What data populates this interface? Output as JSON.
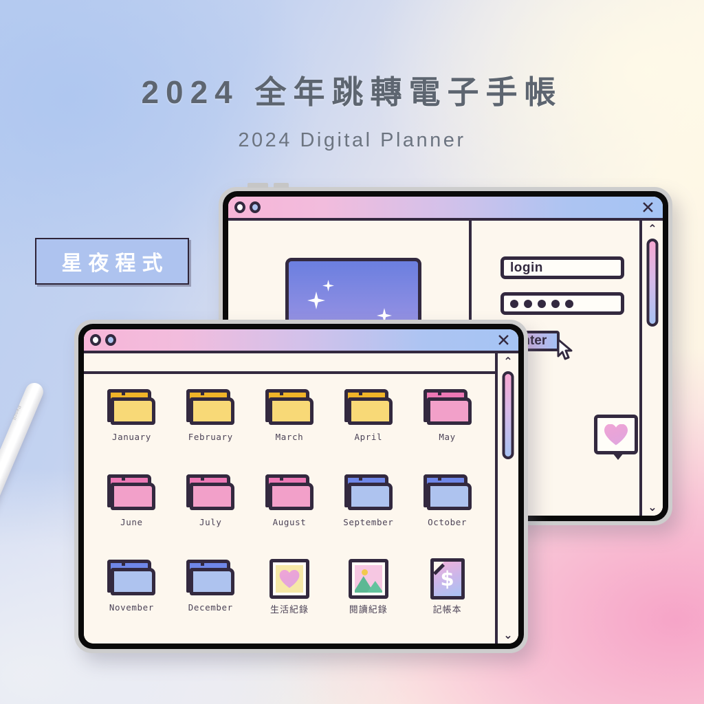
{
  "page": {
    "title": "2024 全年跳轉電子手帳",
    "subtitle": "2024 Digital Planner",
    "badge": "星夜程式"
  },
  "colors": {
    "outline": "#33293f",
    "paper": "#fdf7ee",
    "pink": "#f7a8d2",
    "blue": "#a5c4f4",
    "folder_yellow": "#f8d977",
    "folder_pink": "#f2a0c9",
    "folder_blue": "#aec3ef"
  },
  "back_window": {
    "titlebar": {
      "dot_left": "circle-white",
      "dot_right": "circle-blue",
      "close": "✕"
    },
    "left_panel": {
      "star_panel": "star-gradient-panel",
      "sparkles": 3
    },
    "login_form": {
      "username_value": "login",
      "password_dots": 5,
      "submit_label": "Enter",
      "cursor": "arrow-cursor"
    },
    "heart_bubble": "heart-speech-bubble",
    "scrollbar": {
      "up": "⌃",
      "down": "⌄"
    }
  },
  "front_window": {
    "titlebar": {
      "dot_left": "circle-white",
      "dot_right": "circle-blue",
      "close": "✕"
    },
    "scrollbar": {
      "up": "⌃",
      "down": "⌄"
    },
    "items": [
      {
        "label": "January",
        "type": "folder",
        "color": "yellow"
      },
      {
        "label": "February",
        "type": "folder",
        "color": "yellow"
      },
      {
        "label": "March",
        "type": "folder",
        "color": "yellow"
      },
      {
        "label": "April",
        "type": "folder",
        "color": "yellow"
      },
      {
        "label": "May",
        "type": "folder",
        "color": "pink"
      },
      {
        "label": "June",
        "type": "folder",
        "color": "pink"
      },
      {
        "label": "July",
        "type": "folder",
        "color": "pink"
      },
      {
        "label": "August",
        "type": "folder",
        "color": "pink"
      },
      {
        "label": "September",
        "type": "folder",
        "color": "blue"
      },
      {
        "label": "October",
        "type": "folder",
        "color": "blue"
      },
      {
        "label": "November",
        "type": "folder",
        "color": "blue"
      },
      {
        "label": "December",
        "type": "folder",
        "color": "blue"
      },
      {
        "label": "生活紀錄",
        "type": "heart-frame",
        "color": "yellow"
      },
      {
        "label": "閱讀紀錄",
        "type": "photo-frame",
        "color": "pink"
      },
      {
        "label": "記帳本",
        "type": "money-doc",
        "color": "gradient",
        "glyph": "$"
      }
    ]
  }
}
